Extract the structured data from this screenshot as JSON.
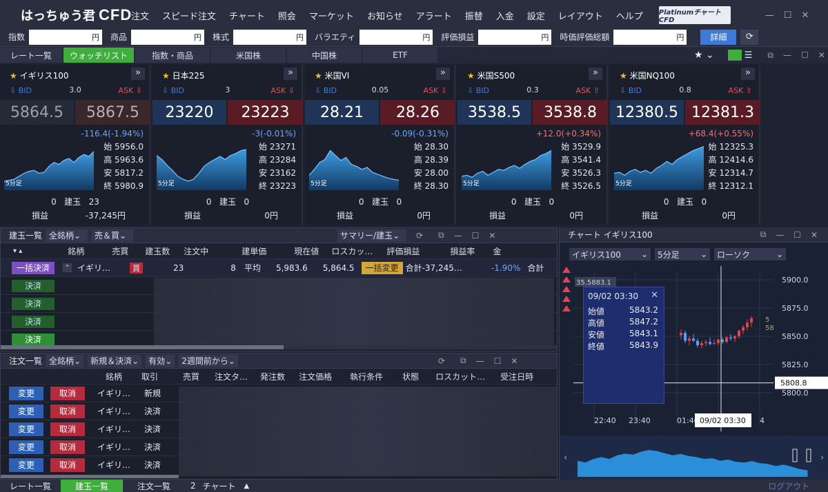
{
  "app": {
    "logo_hira": "はっちゅう君",
    "logo_cfd": "CFD",
    "platinum_logo": "Platinumチャート CFD"
  },
  "menu": [
    "注文",
    "スピード注文",
    "チャート",
    "照会",
    "マーケット",
    "お知らせ",
    "アラート",
    "振替",
    "入金",
    "設定",
    "レイアウト",
    "ヘルプ"
  ],
  "account": {
    "items": [
      {
        "label": "指数",
        "value": "円"
      },
      {
        "label": "商品",
        "value": "円"
      },
      {
        "label": "株式",
        "value": "円"
      },
      {
        "label": "バラエティ",
        "value": "円"
      },
      {
        "label": "評価損益",
        "value": "円"
      },
      {
        "label": "時価評価総額",
        "value": "円"
      }
    ],
    "detail_button": "詳細"
  },
  "rate_tabs": [
    {
      "label": "レート一覧",
      "active": false
    },
    {
      "label": "ウォッチリスト",
      "active": true
    },
    {
      "label": "指数・商品",
      "active": false
    },
    {
      "label": "米国株",
      "active": false
    },
    {
      "label": "中国株",
      "active": false
    },
    {
      "label": "ETF",
      "active": false
    }
  ],
  "cards": [
    {
      "name": "イギリス100",
      "bid_label": "BID",
      "ask_label": "ASK",
      "spread": "3.0",
      "bid": "5864.5",
      "ask": "5867.5",
      "change": "-116.4(-1.94%)",
      "change_dir": "down",
      "open": "始 5956.0",
      "high": "高 5963.6",
      "low": "安 5817.2",
      "close": "終 5980.9",
      "tf": "5分足",
      "pos_qty": "0",
      "pos_label": "建玉",
      "pos_qty2": "23",
      "pl_label": "損益",
      "pl_value": "-37,245円",
      "dim": true,
      "spark": [
        0.18,
        0.2,
        0.22,
        0.28,
        0.34,
        0.38,
        0.4,
        0.34,
        0.36,
        0.48,
        0.56,
        0.52,
        0.6,
        0.64,
        0.56,
        0.66,
        0.72,
        0.68,
        0.78
      ]
    },
    {
      "name": "日本225",
      "bid_label": "BID",
      "ask_label": "ASK",
      "spread": "3",
      "bid": "23220",
      "ask": "23223",
      "change": "-3(-0.01%)",
      "change_dir": "down",
      "open": "始 23271",
      "high": "高 23284",
      "low": "安 23162",
      "close": "終 23223",
      "tf": "5分足",
      "pos_qty": "0",
      "pos_label": "建玉",
      "pos_qty2": "0",
      "pl_label": "損益",
      "pl_value": "0円",
      "dim": false,
      "spark": [
        0.7,
        0.62,
        0.5,
        0.4,
        0.28,
        0.22,
        0.18,
        0.22,
        0.34,
        0.48,
        0.56,
        0.62,
        0.68,
        0.62,
        0.7,
        0.74,
        0.8,
        0.82
      ]
    },
    {
      "name": "米国VI",
      "bid_label": "BID",
      "ask_label": "ASK",
      "spread": "0.05",
      "bid": "28.21",
      "ask": "28.26",
      "change": "-0.09(-0.31%)",
      "change_dir": "down",
      "open": "始 28.30",
      "high": "高 28.39",
      "low": "安 28.00",
      "close": "終 28.30",
      "tf": "5分足",
      "pos_qty": "0",
      "pos_label": "建玉",
      "pos_qty2": "0",
      "pl_label": "損益",
      "pl_value": "0円",
      "dim": false,
      "spark": [
        0.3,
        0.42,
        0.56,
        0.62,
        0.8,
        0.7,
        0.6,
        0.66,
        0.52,
        0.48,
        0.42,
        0.46,
        0.36,
        0.32,
        0.28,
        0.24,
        0.22,
        0.2
      ]
    },
    {
      "name": "米国S500",
      "bid_label": "BID",
      "ask_label": "ASK",
      "spread": "0.3",
      "bid": "3538.5",
      "ask": "3538.8",
      "change": "+12.0(+0.34%)",
      "change_dir": "up",
      "open": "始 3529.9",
      "high": "高 3541.4",
      "low": "安 3526.3",
      "close": "終 3526.5",
      "tf": "5分足",
      "pos_qty": "0",
      "pos_label": "建玉",
      "pos_qty2": "0",
      "pl_label": "損益",
      "pl_value": "0円",
      "dim": false,
      "spark": [
        0.28,
        0.3,
        0.26,
        0.34,
        0.38,
        0.3,
        0.36,
        0.42,
        0.4,
        0.46,
        0.5,
        0.44,
        0.52,
        0.58,
        0.62,
        0.7,
        0.74,
        0.8
      ]
    },
    {
      "name": "米国NQ100",
      "bid_label": "BID",
      "ask_label": "ASK",
      "spread": "0.8",
      "bid": "12380.5",
      "ask": "12381.3",
      "change": "+68.4(+0.55%)",
      "change_dir": "up",
      "open": "始 12325.3",
      "high": "高 12414.6",
      "low": "安 12314.7",
      "close": "終 12312.1",
      "tf": "5分足",
      "pos_qty": "0",
      "pos_label": "建玉",
      "pos_qty2": "0",
      "pl_label": "損益",
      "pl_value": "0円",
      "dim": false,
      "spark": [
        0.34,
        0.36,
        0.3,
        0.38,
        0.42,
        0.36,
        0.4,
        0.34,
        0.44,
        0.5,
        0.58,
        0.52,
        0.62,
        0.68,
        0.74,
        0.8,
        0.84,
        0.88
      ]
    }
  ],
  "positions": {
    "title": "建玉一覧",
    "filter1": "全銘柄",
    "filter2": "売＆買",
    "summary": "サマリー/建玉",
    "columns": [
      "銘柄",
      "売買",
      "建玉数",
      "注文中",
      "建単価",
      "現在値",
      "ロスカッ…",
      "評価損益",
      "損益率",
      "金"
    ],
    "row": {
      "bulk_close": "一括決済",
      "symbol": "イギリ…",
      "side": "買",
      "qty": "23",
      "ordering": "8",
      "avg_label": "平均",
      "price": "5,983.6",
      "current": "5,864.5",
      "bulk_change": "一括変更",
      "pl": "合計-37,245…",
      "rate": "-1.90%",
      "total": "合計"
    },
    "close_btn": "決済"
  },
  "orders": {
    "title": "注文一覧",
    "filter1": "全銘柄",
    "filter2": "新規＆決済",
    "filter3": "有効",
    "filter4": "2週間前から",
    "columns": [
      "銘柄",
      "取引",
      "売買",
      "注文タ…",
      "発注数",
      "注文価格",
      "執行条件",
      "状態",
      "ロスカット…",
      "受注日時"
    ],
    "rows": [
      {
        "change": "変更",
        "cancel": "取消",
        "symbol": "イギリ…",
        "type": "新規"
      },
      {
        "change": "変更",
        "cancel": "取消",
        "symbol": "イギリ…",
        "type": "決済"
      },
      {
        "change": "変更",
        "cancel": "取消",
        "symbol": "イギリ…",
        "type": "決済"
      },
      {
        "change": "変更",
        "cancel": "取消",
        "symbol": "イギリ…",
        "type": "決済"
      },
      {
        "change": "変更",
        "cancel": "取消",
        "symbol": "イギリ…",
        "type": "決済"
      }
    ]
  },
  "chart": {
    "title": "チャート イギリス100",
    "symbol": "イギリス100",
    "timeframe": "5分足",
    "style": "ローソク",
    "yticks": [
      "5900.0",
      "5875.0",
      "5850.0",
      "5825.0",
      "5800.0"
    ],
    "current_price": "5808.8",
    "top_tag": "35.5883.1",
    "xticks": [
      "22:40",
      "23:40",
      "01:40",
      "4"
    ],
    "x_cursor": "09/02 03:30",
    "tooltip": {
      "time": "09/02 03:30",
      "open_label": "始値",
      "open": "5843.2",
      "high_label": "高値",
      "high": "5847.2",
      "low_label": "安値",
      "low": "5843.1",
      "close_label": "終値",
      "close": "5843.9"
    },
    "edge_labels": [
      "5",
      "58"
    ]
  },
  "bottom_tabs": [
    {
      "label": "レート一覧",
      "active": false
    },
    {
      "label": "建玉一覧",
      "active": true
    },
    {
      "label": "注文一覧",
      "active": false
    }
  ],
  "bottom_chart_count": "2",
  "bottom_chart_label": "チャート",
  "logout": "ログアウト"
}
